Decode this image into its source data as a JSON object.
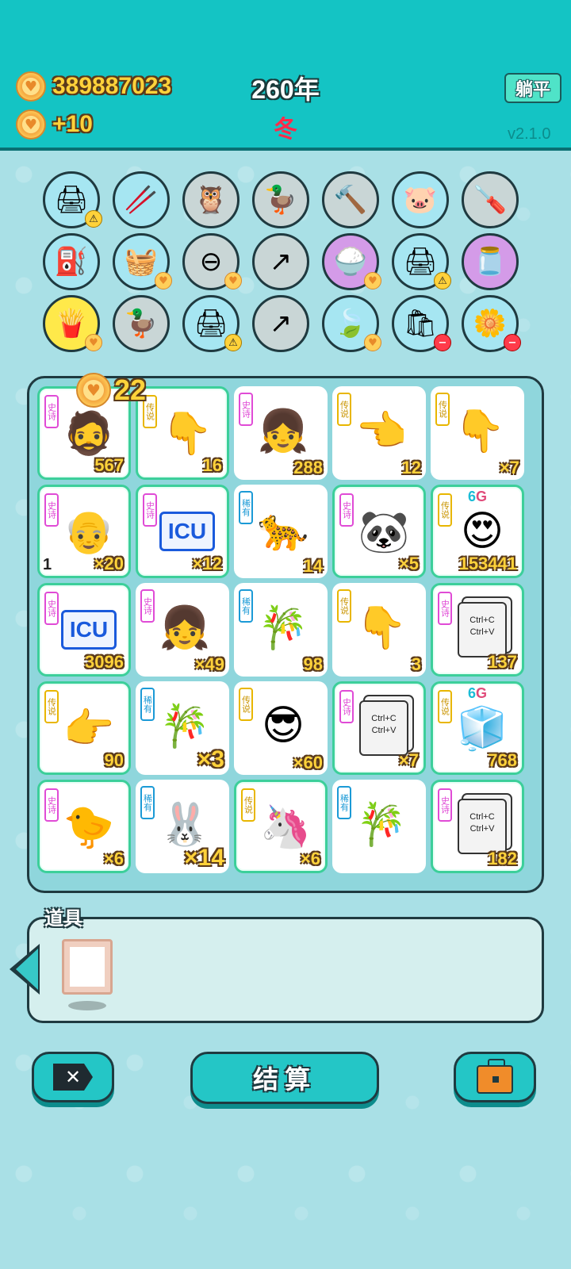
{
  "header": {
    "coins": "389887023",
    "coin_income": "+10",
    "year": "260年",
    "season": "冬",
    "flat_label": "躺平",
    "version": "v2.1.0"
  },
  "item_circles": [
    {
      "icon": "printer-icon",
      "glyph": "🖨",
      "color": "blue",
      "badge": "warn"
    },
    {
      "icon": "chopsticks-icon",
      "glyph": "🥢",
      "color": "blue",
      "badge": ""
    },
    {
      "icon": "owl-icon",
      "glyph": "🦉",
      "color": "grey",
      "badge": ""
    },
    {
      "icon": "pot-duck-icon",
      "glyph": "🦆",
      "color": "grey",
      "badge": ""
    },
    {
      "icon": "hammer-icon",
      "glyph": "🔨",
      "color": "grey",
      "badge": ""
    },
    {
      "icon": "piggy-bank-icon",
      "glyph": "🐷",
      "color": "blue",
      "badge": ""
    },
    {
      "icon": "screwdriver-icon",
      "glyph": "🪛",
      "color": "grey",
      "badge": ""
    },
    {
      "icon": "pump-icon",
      "glyph": "⛽",
      "color": "blue",
      "badge": ""
    },
    {
      "icon": "fruit-basket-icon",
      "glyph": "🧺",
      "color": "blue",
      "badge": "heart"
    },
    {
      "icon": "minus-sign-icon",
      "glyph": "⊖",
      "color": "grey",
      "badge": "heart"
    },
    {
      "icon": "arrow-up-right-icon",
      "glyph": "↗",
      "color": "grey",
      "badge": ""
    },
    {
      "icon": "rice-bowl-icon",
      "glyph": "🍚",
      "color": "purple",
      "badge": "heart"
    },
    {
      "icon": "printer-icon",
      "glyph": "🖨",
      "color": "blue",
      "badge": "warn"
    },
    {
      "icon": "jar-icon",
      "glyph": "🫙",
      "color": "purple",
      "badge": ""
    },
    {
      "icon": "french-fries-icon",
      "glyph": "🍟",
      "color": "yellow",
      "badge": "heart"
    },
    {
      "icon": "pot-duck-icon",
      "glyph": "🦆",
      "color": "grey",
      "badge": ""
    },
    {
      "icon": "printer-icon",
      "glyph": "🖨",
      "color": "blue",
      "badge": "warn"
    },
    {
      "icon": "arrow-up-right-icon",
      "glyph": "↗",
      "color": "grey",
      "badge": ""
    },
    {
      "icon": "leaf-icon",
      "glyph": "🍃",
      "color": "blue",
      "badge": "heart"
    },
    {
      "icon": "garbage-bag-icon",
      "glyph": "🛍",
      "color": "blue",
      "badge": "minus"
    },
    {
      "icon": "potted-flower-icon",
      "glyph": "🌼",
      "color": "blue",
      "badge": "minus"
    }
  ],
  "bonus": "22",
  "board": [
    {
      "tag": "史诗",
      "rarity": "epic",
      "icon": "old-man-mask-icon",
      "glyph": "🧔",
      "count": "567",
      "big": false,
      "glow": true,
      "extra": "",
      "six_g": false
    },
    {
      "tag": "传说",
      "rarity": "legend",
      "icon": "pointing-hand-icon",
      "glyph": "👇",
      "count": "16",
      "big": false,
      "glow": true,
      "extra": "",
      "six_g": false
    },
    {
      "tag": "史诗",
      "rarity": "epic",
      "icon": "braided-girl-icon",
      "glyph": "👧",
      "count": "288",
      "big": false,
      "glow": false,
      "extra": "",
      "six_g": false
    },
    {
      "tag": "传说",
      "rarity": "legend",
      "icon": "pointing-hand-icon",
      "glyph": "👈",
      "count": "12",
      "big": false,
      "glow": false,
      "extra": "",
      "six_g": false
    },
    {
      "tag": "传说",
      "rarity": "legend",
      "icon": "pointing-hand-icon",
      "glyph": "👇",
      "count": "×7",
      "big": false,
      "glow": false,
      "extra": "",
      "six_g": false
    },
    {
      "tag": "史诗",
      "rarity": "epic",
      "icon": "grandpa-icon",
      "glyph": "👴",
      "count": "×20",
      "big": false,
      "glow": true,
      "extra": "1",
      "six_g": false
    },
    {
      "tag": "史诗",
      "rarity": "epic",
      "icon": "icu-sign-icon",
      "glyph": "ICU",
      "count": "×12",
      "big": false,
      "glow": true,
      "extra": "",
      "six_g": false
    },
    {
      "tag": "稀有",
      "rarity": "rare",
      "icon": "leopard-icon",
      "glyph": "🐆",
      "count": "14",
      "big": false,
      "glow": false,
      "extra": "",
      "six_g": false
    },
    {
      "tag": "史诗",
      "rarity": "epic",
      "icon": "panda-icon",
      "glyph": "🐼",
      "count": "×5",
      "big": false,
      "glow": true,
      "extra": "",
      "six_g": false
    },
    {
      "tag": "传说",
      "rarity": "legend",
      "icon": "bald-man-icon",
      "glyph": "😍",
      "count": "153441",
      "big": false,
      "glow": true,
      "extra": "",
      "six_g": true
    },
    {
      "tag": "史诗",
      "rarity": "epic",
      "icon": "icu-sign-icon",
      "glyph": "ICU",
      "count": "3096",
      "big": false,
      "glow": true,
      "extra": "",
      "six_g": false
    },
    {
      "tag": "史诗",
      "rarity": "epic",
      "icon": "braided-girl-icon",
      "glyph": "👧",
      "count": "×49",
      "big": false,
      "glow": false,
      "extra": "",
      "six_g": false
    },
    {
      "tag": "稀有",
      "rarity": "rare",
      "icon": "bamboo-icon",
      "glyph": "🎋",
      "count": "98",
      "big": false,
      "glow": false,
      "extra": "",
      "six_g": false
    },
    {
      "tag": "传说",
      "rarity": "legend",
      "icon": "pointing-hand-icon",
      "glyph": "👇",
      "count": "3",
      "big": false,
      "glow": false,
      "extra": "",
      "six_g": false
    },
    {
      "tag": "史诗",
      "rarity": "epic",
      "icon": "copy-paste-icon",
      "glyph": "COPY",
      "count": "137",
      "big": false,
      "glow": true,
      "extra": "",
      "six_g": false
    },
    {
      "tag": "传说",
      "rarity": "legend",
      "icon": "pointing-hand-icon",
      "glyph": "👉",
      "count": "90",
      "big": false,
      "glow": true,
      "extra": "",
      "six_g": false
    },
    {
      "tag": "稀有",
      "rarity": "rare",
      "icon": "bamboo-icon",
      "glyph": "🎋",
      "count": "×3",
      "big": true,
      "glow": false,
      "extra": "",
      "six_g": false
    },
    {
      "tag": "传说",
      "rarity": "legend",
      "icon": "sunglasses-man-icon",
      "glyph": "😎",
      "count": "×60",
      "big": false,
      "glow": false,
      "extra": "",
      "six_g": false
    },
    {
      "tag": "史诗",
      "rarity": "epic",
      "icon": "copy-paste-icon",
      "glyph": "COPY",
      "count": "×7",
      "big": false,
      "glow": true,
      "extra": "",
      "six_g": false
    },
    {
      "tag": "传说",
      "rarity": "legend",
      "icon": "fridge-icon",
      "glyph": "🧊",
      "count": "768",
      "big": false,
      "glow": true,
      "extra": "",
      "six_g": true
    },
    {
      "tag": "史诗",
      "rarity": "epic",
      "icon": "chick-icon",
      "glyph": "🐤",
      "count": "×6",
      "big": false,
      "glow": true,
      "extra": "",
      "six_g": false
    },
    {
      "tag": "稀有",
      "rarity": "rare",
      "icon": "rabbit-icon",
      "glyph": "🐰",
      "count": "×14",
      "big": true,
      "glow": false,
      "extra": "",
      "six_g": false
    },
    {
      "tag": "传说",
      "rarity": "legend",
      "icon": "unicorn-icon",
      "glyph": "🦄",
      "count": "×6",
      "big": false,
      "glow": true,
      "extra": "",
      "six_g": false
    },
    {
      "tag": "稀有",
      "rarity": "rare",
      "icon": "bamboo-icon",
      "glyph": "🎋",
      "count": "",
      "big": false,
      "glow": false,
      "extra": "",
      "six_g": false
    },
    {
      "tag": "史诗",
      "rarity": "epic",
      "icon": "copy-paste-icon",
      "glyph": "COPY",
      "count": "182",
      "big": false,
      "glow": true,
      "extra": "",
      "six_g": false
    }
  ],
  "copy_text": [
    "Ctrl+C",
    "Ctrl+V"
  ],
  "six_g": {
    "six": "6",
    "g": "G"
  },
  "props": {
    "title": "道具"
  },
  "buttons": {
    "settle": "结算",
    "exit_glyph": "✕"
  }
}
